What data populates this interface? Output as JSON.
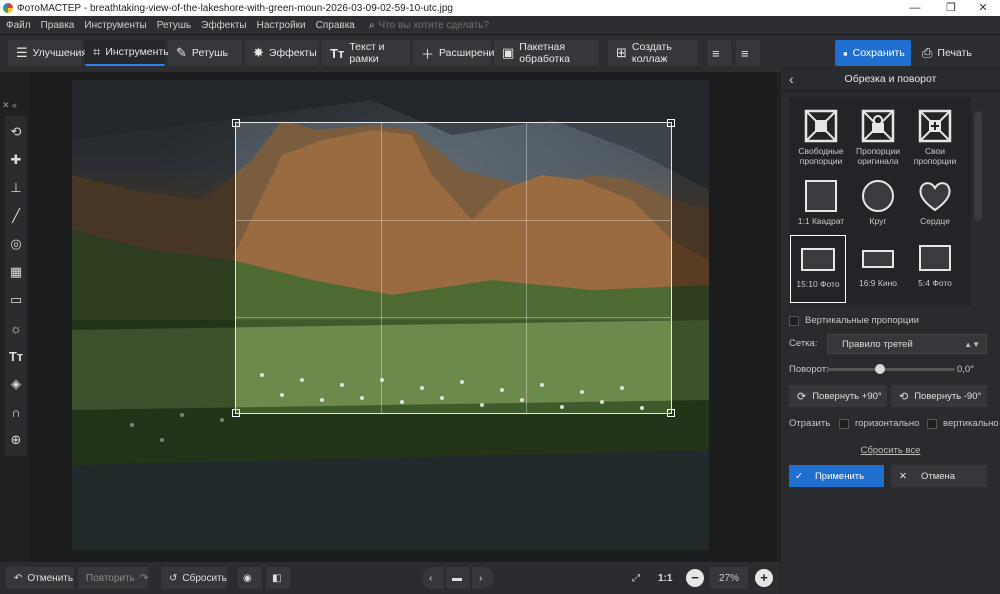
{
  "window": {
    "title": "ФотоМАСТЕР - breathtaking-view-of-the-lakeshore-with-green-moun-2026-03-09-02-59-10-utc.jpg"
  },
  "menu": {
    "items": [
      "Файл",
      "Правка",
      "Инструменты",
      "Ретушь",
      "Эффекты",
      "Настройки",
      "Справка"
    ],
    "search_placeholder": "Что вы хотите сделать?"
  },
  "toolbar": {
    "tabs": [
      {
        "label": "Улучшения",
        "icon": "sliders-icon"
      },
      {
        "label": "Инструменты",
        "icon": "crop-icon",
        "active": true
      },
      {
        "label": "Ретушь",
        "icon": "brush-icon"
      },
      {
        "label": "Эффекты",
        "icon": "magic-wand-icon"
      },
      {
        "label": "Текст и рамки",
        "icon": "text-icon"
      },
      {
        "label": "Расширения",
        "icon": "plus-icon"
      }
    ],
    "batch_label": "Пакетная обработка",
    "collage_label": "Создать коллаж",
    "save_label": "Сохранить",
    "print_label": "Печать"
  },
  "bottombar": {
    "undo_label": "Отменить",
    "redo_label": "Повторить",
    "reset_label": "Сбросить",
    "ratio_label": "1:1",
    "zoom_value": "27%"
  },
  "panel": {
    "title": "Обрезка и поворот",
    "presets": [
      {
        "label": "Свободные пропорции",
        "shape": "free"
      },
      {
        "label": "Пропорции оригинала",
        "shape": "lock"
      },
      {
        "label": "Свои пропорции",
        "shape": "custom"
      },
      {
        "label": "1:1 Квадрат",
        "shape": "square"
      },
      {
        "label": "Круг",
        "shape": "circle"
      },
      {
        "label": "Сердце",
        "shape": "heart"
      },
      {
        "label": "15:10 Фото",
        "shape": "rect-15-10",
        "selected": true
      },
      {
        "label": "16:9 Кино",
        "shape": "rect-16-9"
      },
      {
        "label": "5:4 Фото",
        "shape": "rect-5-4"
      }
    ],
    "vertical_label": "Вертикальные пропорции",
    "grid_label": "Сетка:",
    "grid_value": "Правило третей",
    "rotation_label": "Поворот:",
    "rotation_value": "0,0°",
    "rotate_plus_label": "Повернуть +90°",
    "rotate_minus_label": "Повернуть -90°",
    "flip_label": "Отразить",
    "flip_h_label": "горизонтально",
    "flip_v_label": "вертикально",
    "reset_all_label": "Сбросить все",
    "apply_label": "Применить",
    "cancel_label": "Отмена"
  },
  "colors": {
    "accent": "#1f6fd1",
    "panel_bg": "#2a2b2e",
    "toolbar_bg": "#2d2e31"
  }
}
